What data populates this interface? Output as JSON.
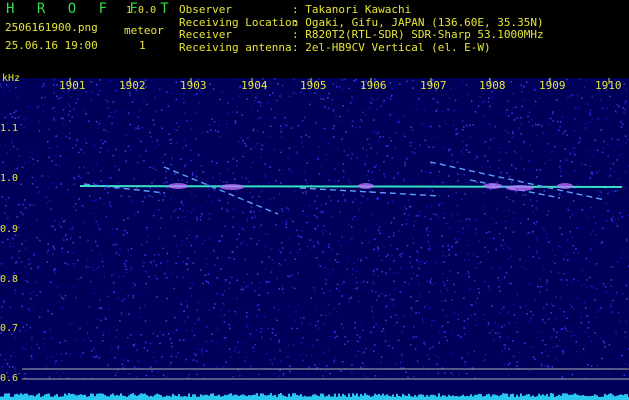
{
  "header": {
    "app_title": "H R O F F T",
    "app_version": "1.0.0",
    "file_name": "2506161900.png",
    "datetime": "25.06.16 19:00",
    "meteor_label": "meteor",
    "meteor_count": "1"
  },
  "info": [
    {
      "key": "Observer",
      "value": ": Takanori Kawachi"
    },
    {
      "key": "Receiving Location",
      "value": ": Ogaki, Gifu, JAPAN (136.60E, 35.35N)"
    },
    {
      "key": "Receiver",
      "value": ": R820T2(RTL-SDR) SDR-Sharp 53.1000MHz"
    },
    {
      "key": "Receiving antenna",
      "value": ": 2el-HB9CV Vertical (el. E-W)"
    }
  ],
  "axis": {
    "y_unit": "kHz",
    "y_ticks": [
      "1.1",
      "1.0",
      "0.9",
      "0.8",
      "0.7",
      "0.6"
    ],
    "x_ticks": [
      "1901",
      "1902",
      "1903",
      "1904",
      "1905",
      "1906",
      "1907",
      "1908",
      "1909",
      "1910"
    ]
  },
  "colors": {
    "text": "#e6e639",
    "title": "#36d94a",
    "background": "#00005a",
    "carrier": "#36e0c0",
    "meteor": "#c070ff"
  }
}
